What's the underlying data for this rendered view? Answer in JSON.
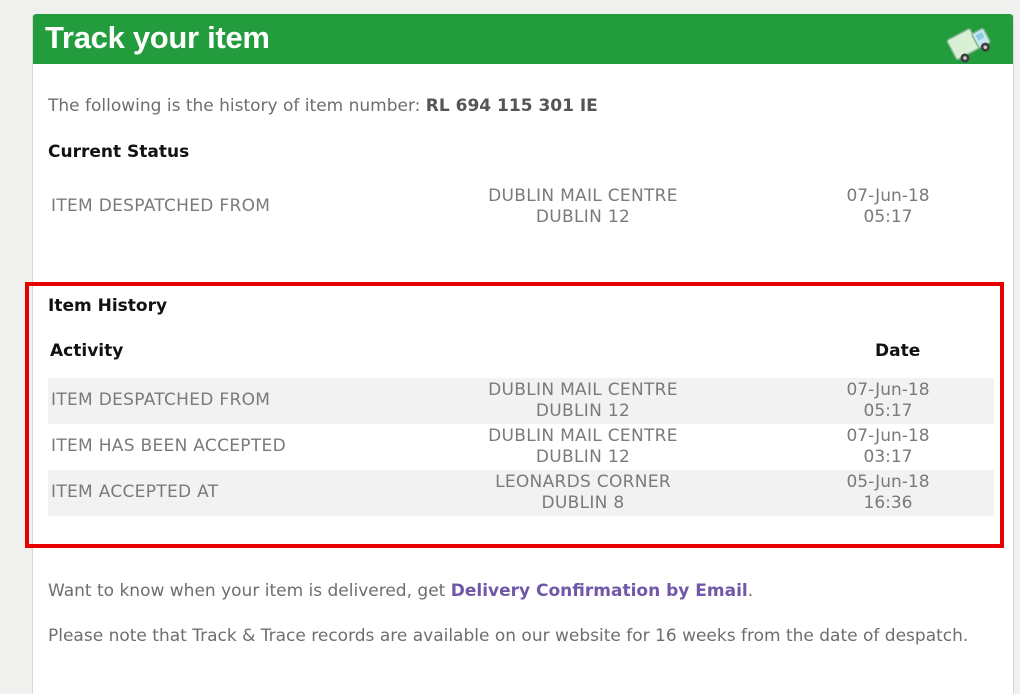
{
  "header": {
    "title": "Track your item"
  },
  "intro": {
    "text": "The following is the history of item number:",
    "item_number": "RL 694 115 301 IE"
  },
  "current_status": {
    "heading": "Current Status",
    "activity": "ITEM DESPATCHED FROM",
    "location_line1": "DUBLIN MAIL CENTRE",
    "location_line2": "DUBLIN 12",
    "date": "07-Jun-18",
    "time": "05:17"
  },
  "history": {
    "heading": "Item History",
    "col_activity": "Activity",
    "col_date": "Date",
    "rows": [
      {
        "activity": "ITEM DESPATCHED FROM",
        "location_line1": "DUBLIN MAIL CENTRE",
        "location_line2": "DUBLIN 12",
        "date": "07-Jun-18",
        "time": "05:17"
      },
      {
        "activity": "ITEM HAS BEEN ACCEPTED",
        "location_line1": "DUBLIN MAIL CENTRE",
        "location_line2": "DUBLIN 12",
        "date": "07-Jun-18",
        "time": "03:17"
      },
      {
        "activity": "ITEM ACCEPTED AT",
        "location_line1": "LEONARDS CORNER",
        "location_line2": "DUBLIN 8",
        "date": "05-Jun-18",
        "time": "16:36"
      }
    ]
  },
  "footer": {
    "delivery_prefix": "Want to know when your item is delivered, get",
    "delivery_link": "Delivery Confirmation by Email",
    "delivery_suffix": ".",
    "note": "Please note that Track & Trace records are available on our website for 16 weeks from the date of despatch."
  },
  "colors": {
    "header_green": "#229c3c",
    "highlight_red": "#e60000",
    "link_purple": "#7057a8"
  },
  "icons": {
    "header_icon": "delivery-truck-icon"
  }
}
